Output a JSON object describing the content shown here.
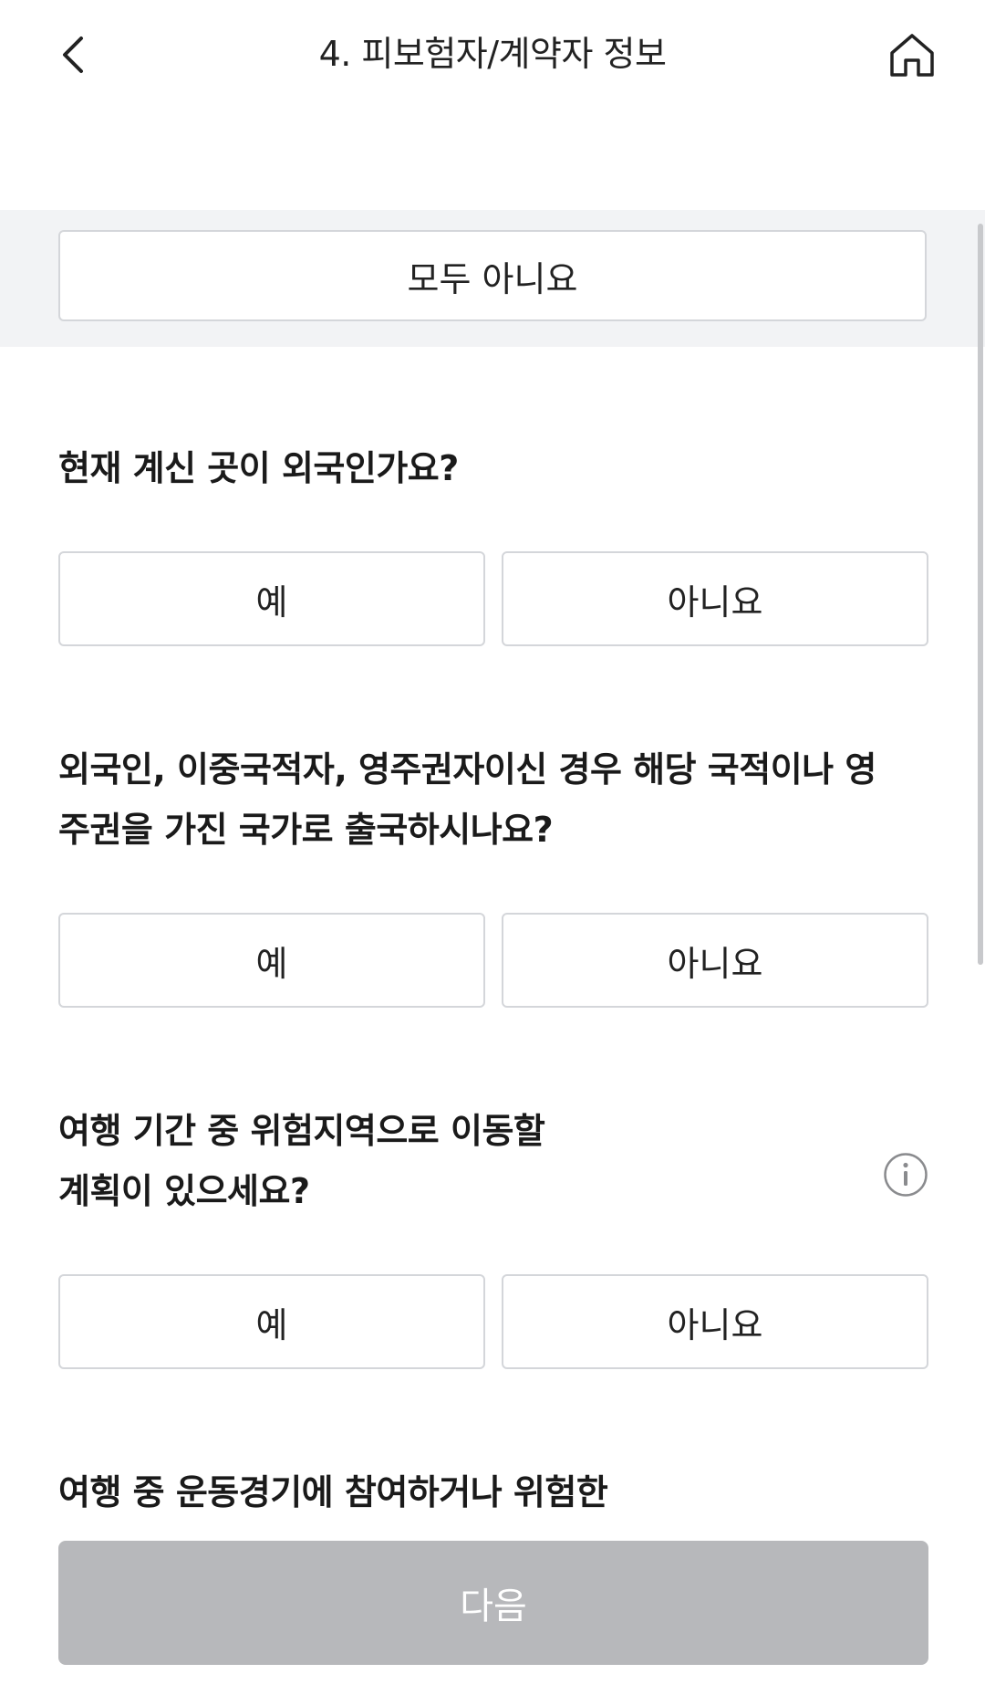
{
  "header": {
    "title": "4. 피보험자/계약자 정보",
    "back_icon": "chevron-left-icon",
    "home_icon": "home-icon"
  },
  "all_no": {
    "label": "모두 아니요"
  },
  "questions": [
    {
      "text": "현재 계신 곳이 외국인가요?",
      "yes": "예",
      "no": "아니요"
    },
    {
      "line1": "외국인, 이중국적자, 영주권자이신 경우 해당 국적이나 영",
      "line2": "주권을 가진 국가로 출국하시나요?",
      "yes": "예",
      "no": "아니요"
    },
    {
      "line1": "여행 기간 중 위험지역으로 이동할",
      "line2": "계획이 있으세요?",
      "yes": "예",
      "no": "아니요",
      "info_icon": "info-icon"
    },
    {
      "text": "여행 중 운동경기에 참여하거나 위험한"
    }
  ],
  "footer": {
    "next_label": "다음",
    "next_disabled_color": "#b7b8bb"
  }
}
